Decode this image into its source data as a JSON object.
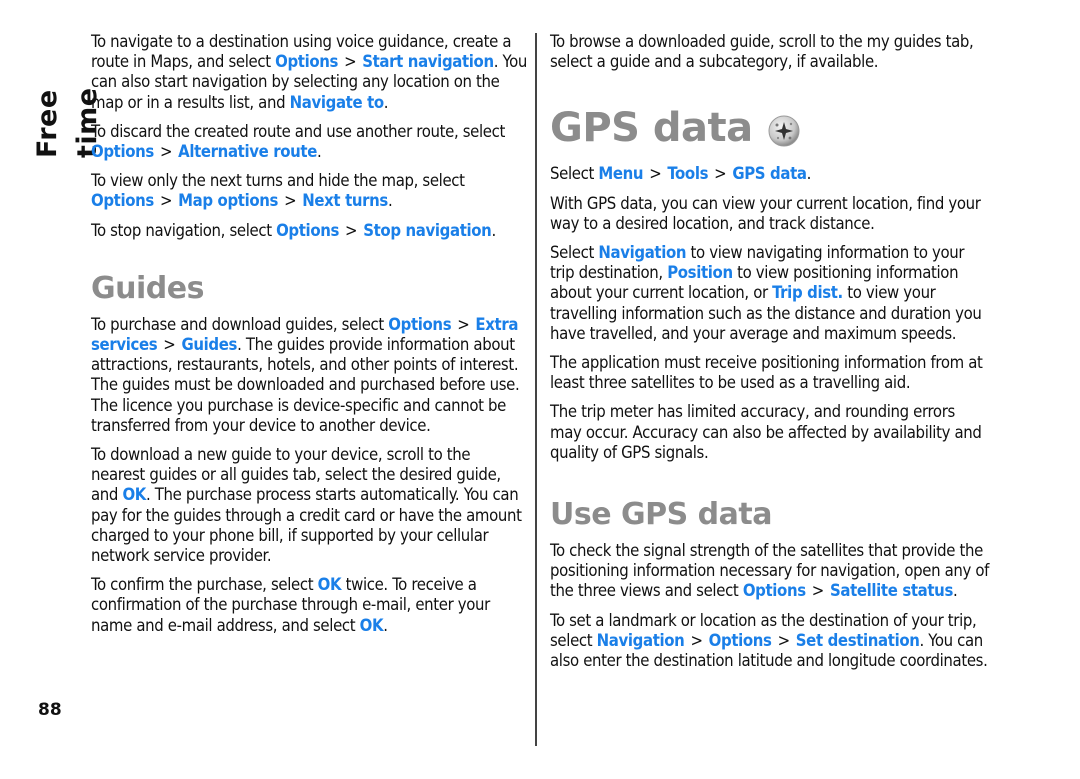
{
  "side_title": "Free time",
  "page_number": "88",
  "colors": {
    "link": "#1a7fe8",
    "heading": "#8c8c8c",
    "text": "#111111",
    "divider": "#444444"
  },
  "left": {
    "p1": {
      "t1": "To navigate to a destination using voice guidance, create a route in Maps, and select ",
      "l1": "Options",
      "sep": ">",
      "l2": "Start navigation",
      "t2": ". You can also start navigation by selecting any location on the map or in a results list, and ",
      "l3": "Navigate to",
      "t3": "."
    },
    "p2": {
      "t1": "To discard the created route and use another route, select ",
      "l1": "Options",
      "sep": ">",
      "l2": "Alternative route",
      "t2": "."
    },
    "p3": {
      "t1": "To view only the next turns and hide the map, select ",
      "l1": "Options",
      "sep": ">",
      "l2": "Map options",
      "l3": "Next turns",
      "t2": "."
    },
    "p4": {
      "t1": "To stop navigation, select ",
      "l1": "Options",
      "sep": ">",
      "l2": "Stop navigation",
      "t2": "."
    },
    "guides_heading": "Guides",
    "p5": {
      "t1": "To purchase and download guides, select ",
      "l1": "Options",
      "sep": ">",
      "l2": "Extra services",
      "l3": "Guides",
      "t2": ". The guides provide information about attractions, restaurants, hotels, and other points of interest. The guides must be downloaded and purchased before use. The licence you purchase is device-specific and cannot be transferred from your device to another device."
    },
    "p6": {
      "t1": "To download a new guide to your device, scroll to the nearest guides or all guides tab, select the desired guide, and ",
      "l1": "OK",
      "t2": ". The purchase process starts automatically. You can pay for the guides through a credit card or have the amount charged to your phone bill, if supported by your cellular network service provider."
    },
    "p7": {
      "t1": "To confirm the purchase, select ",
      "l1": "OK",
      "t2": " twice. To receive a confirmation of the purchase through e-mail, enter your name and e-mail address, and select ",
      "l2": "OK",
      "t3": "."
    }
  },
  "right": {
    "p1": "To browse a downloaded guide, scroll to the my guides tab, select a guide and a subcategory, if available.",
    "gps_heading": "GPS data",
    "gps_icon": "gps-satellite-icon",
    "p2": {
      "t1": "Select ",
      "l1": "Menu",
      "sep": ">",
      "l2": "Tools",
      "l3": "GPS data",
      "t2": "."
    },
    "p3": "With GPS data, you can view your current location, find your way to a desired location, and track distance.",
    "p4": {
      "t1": "Select ",
      "l1": "Navigation",
      "t2": " to view navigating information to your trip destination, ",
      "l2": "Position",
      "t3": " to view positioning information about your current location, or ",
      "l3": "Trip dist.",
      "t4": " to view your travelling information such as the distance and duration you have travelled, and your average and maximum speeds."
    },
    "p5": "The application must receive positioning information from at least three satellites to be used as a travelling aid.",
    "p6": "The trip meter has limited accuracy, and rounding errors may occur. Accuracy can also be affected by availability and quality of GPS signals.",
    "use_heading": "Use GPS data",
    "p7": {
      "t1": "To check the signal strength of the satellites that provide the positioning information necessary for navigation, open any of the three views and select ",
      "l1": "Options",
      "sep": ">",
      "l2": "Satellite status",
      "t2": "."
    },
    "p8": {
      "t1": "To set a landmark or location as the destination of your trip, select ",
      "l1": "Navigation",
      "sep": ">",
      "l2": "Options",
      "l3": "Set destination",
      "t2": ". You can also enter the destination latitude and longitude coordinates."
    }
  }
}
